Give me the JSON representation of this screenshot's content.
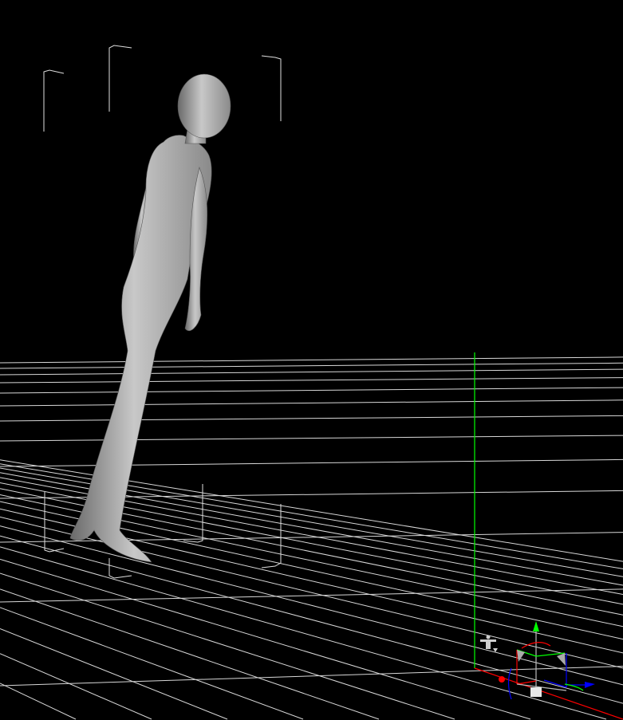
{
  "viewport": {
    "background": "#000000",
    "grid_color": "#d8d8d8",
    "figure_color": "#b4b4b4"
  },
  "axes": {
    "x_color": "#ff0000",
    "y_color": "#00ff00",
    "z_color": "#0000ff"
  },
  "icons": [
    "figure-pose-icon",
    "transform-gizmo-icon",
    "bounding-box-corners-icon"
  ]
}
